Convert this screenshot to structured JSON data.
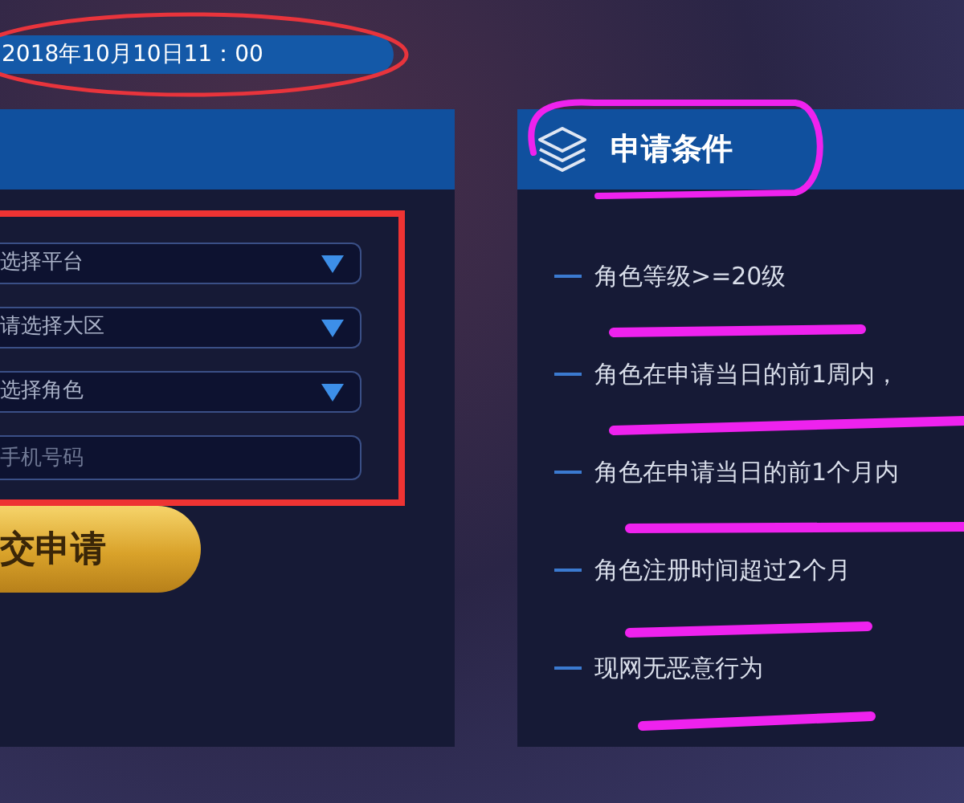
{
  "date_bar": {
    "text": "2018年10月10日11：00"
  },
  "form": {
    "selects": [
      {
        "placeholder": "选择平台"
      },
      {
        "placeholder": "请选择大区"
      },
      {
        "placeholder": "选择角色"
      }
    ],
    "phone": {
      "placeholder": "手机号码"
    },
    "submit": "交申请"
  },
  "conditions": {
    "title": "申请条件",
    "items": [
      "角色等级>=20级",
      "角色在申请当日的前1周内，",
      "角色在申请当日的前1个月内",
      "角色注册时间超过2个月",
      "现网无恶意行为"
    ]
  }
}
